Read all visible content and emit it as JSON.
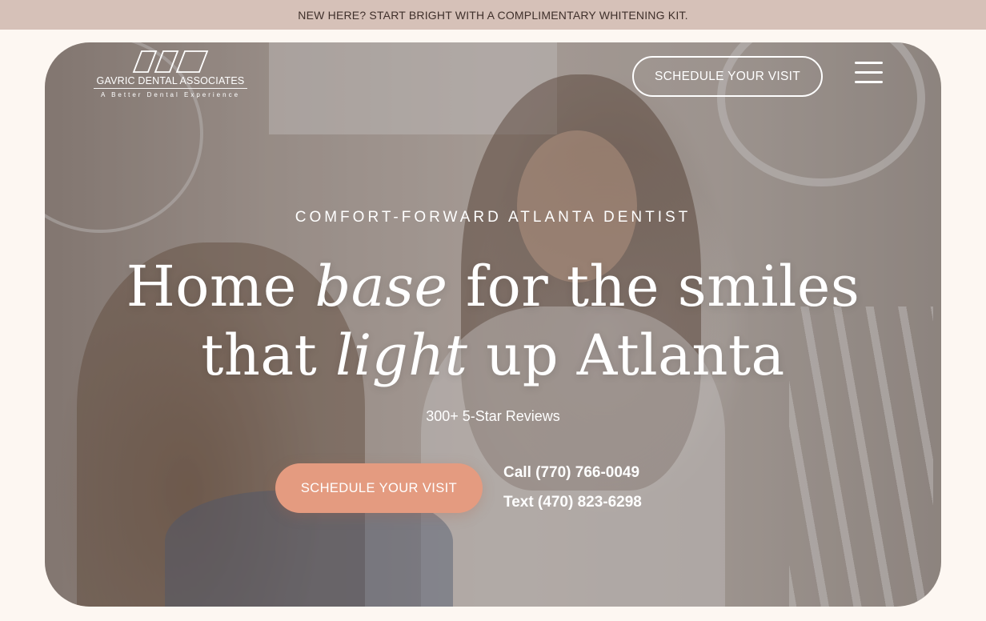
{
  "announcement": {
    "text": "NEW HERE? START BRIGHT WITH A COMPLIMENTARY WHITENING KIT."
  },
  "logo": {
    "name": "GAVRIC DENTAL ASSOCIATES",
    "tagline": "A Better Dental Experience",
    "icon": "logo-mark"
  },
  "nav": {
    "cta_label": "SCHEDULE YOUR VISIT",
    "menu_icon": "hamburger-icon"
  },
  "hero": {
    "eyebrow": "COMFORT-FORWARD ATLANTA DENTIST",
    "headline": {
      "part1": "Home ",
      "italic1": "base",
      "part2": " for the smiles",
      "part3": "that ",
      "italic2": "light",
      "part4": " up Atlanta"
    },
    "reviews": "300+ 5-Star Reviews",
    "cta_label": "SCHEDULE YOUR VISIT",
    "call": "Call (770) 766-0049",
    "text": "Text (470) 823-6298"
  },
  "colors": {
    "announcement_bg": "#d6c1b8",
    "accent": "#e49b80",
    "page_bg": "#fdf7f2"
  }
}
